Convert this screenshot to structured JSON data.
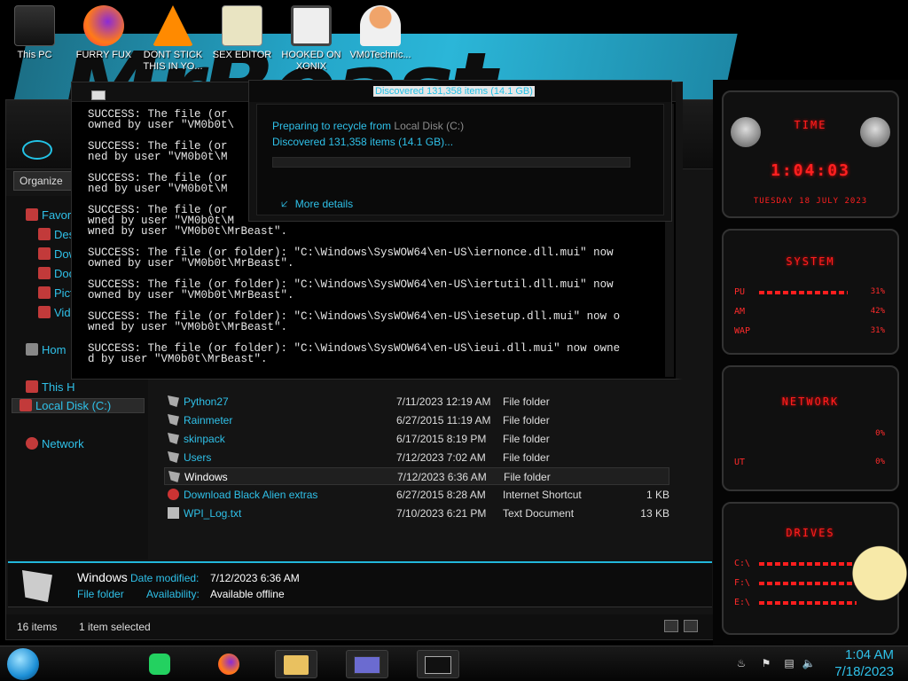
{
  "desktop": {
    "wallpaper_text": "MrBeast",
    "icons": [
      {
        "label": "This PC"
      },
      {
        "label": "FURRY FUX"
      },
      {
        "label": "DONT STICK THIS IN YO..."
      },
      {
        "label": "SEX EDITOR"
      },
      {
        "label": "HOOKED ON XONIX"
      },
      {
        "label": "VM0Technic..."
      }
    ]
  },
  "explorer": {
    "organize_label": "Organize",
    "nav": [
      {
        "label": "Favor"
      },
      {
        "label": "Des"
      },
      {
        "label": "Dow"
      },
      {
        "label": "Doc"
      },
      {
        "label": "Pict"
      },
      {
        "label": "Vide"
      },
      {
        "label": "Hom"
      },
      {
        "label": "This H"
      },
      {
        "label": "Local Disk (C:)"
      },
      {
        "label": "Network"
      }
    ],
    "files": [
      {
        "name": "Python27",
        "date": "7/11/2023 12:19 AM",
        "type": "File folder",
        "size": ""
      },
      {
        "name": "Rainmeter",
        "date": "6/27/2015 11:19 AM",
        "type": "File folder",
        "size": ""
      },
      {
        "name": "skinpack",
        "date": "6/17/2015 8:19 PM",
        "type": "File folder",
        "size": ""
      },
      {
        "name": "Users",
        "date": "7/12/2023 7:02 AM",
        "type": "File folder",
        "size": ""
      },
      {
        "name": "Windows",
        "date": "7/12/2023 6:36 AM",
        "type": "File folder",
        "size": ""
      },
      {
        "name": "Download Black Alien extras",
        "date": "6/27/2015 8:28 AM",
        "type": "Internet Shortcut",
        "size": "1 KB"
      },
      {
        "name": "WPI_Log.txt",
        "date": "7/10/2023 6:21 PM",
        "type": "Text Document",
        "size": "13 KB"
      }
    ],
    "details": {
      "name": "Windows",
      "type": "File folder",
      "modified_label": "Date modified:",
      "modified_value": "7/12/2023 6:36 AM",
      "availability_label": "Availability:",
      "availability_value": "Available offline"
    },
    "status": {
      "items": "16 items",
      "selected": "1 item selected"
    }
  },
  "cmd": {
    "lines": "SUCCESS: The file (or\nowned by user \"VM0b0t\\\n\nSUCCESS: The file (or\nned by user \"VM0b0t\\M\n\nSUCCESS: The file (or\nned by user \"VM0b0t\\M\n\nSUCCESS: The file (or\nwned by user \"VM0b0t\\M\nwned by user \"VM0b0t\\MrBeast\".\n\nSUCCESS: The file (or folder): \"C:\\Windows\\SysWOW64\\en-US\\iernonce.dll.mui\" now\nowned by user \"VM0b0t\\MrBeast\".\n\nSUCCESS: The file (or folder): \"C:\\Windows\\SysWOW64\\en-US\\iertutil.dll.mui\" now\nowned by user \"VM0b0t\\MrBeast\".\n\nSUCCESS: The file (or folder): \"C:\\Windows\\SysWOW64\\en-US\\iesetup.dll.mui\" now o\nwned by user \"VM0b0t\\MrBeast\".\n\nSUCCESS: The file (or folder): \"C:\\Windows\\SysWOW64\\en-US\\ieui.dll.mui\" now owne\nd by user \"VM0b0t\\MrBeast\"."
  },
  "progress": {
    "title": "Discovered 131,358 items (14.1 GB)",
    "line1_prefix": "Preparing to recycle from",
    "line1_source": "Local Disk (C:)",
    "line2": "Discovered 131,358 items (14.1 GB)...",
    "more_details": "More details",
    "progress_fraction": 0.0
  },
  "gadgets": {
    "time": {
      "title": "TIME",
      "clock": "1:04:03",
      "date": "TUESDAY 18 JULY 2023"
    },
    "system": {
      "title": "SYSTEM",
      "rows": [
        {
          "label": "PU",
          "value": "31%"
        },
        {
          "label": "AM",
          "value": "42%"
        },
        {
          "label": "WAP",
          "value": "31%"
        }
      ]
    },
    "network": {
      "title": "NETWORK",
      "rows": [
        {
          "label": "",
          "value": "0%"
        },
        {
          "label": "UT",
          "value": "0%"
        }
      ]
    },
    "drives": {
      "title": "DRIVES",
      "rows": [
        {
          "label": "C:\\"
        },
        {
          "label": "F:\\"
        },
        {
          "label": "E:\\"
        }
      ]
    }
  },
  "taskbar": {
    "time": "1:04 AM",
    "date": "7/18/2023",
    "apps": [
      "spotify-app",
      "firefox-app",
      "file-explorer-app",
      "control-panel-app",
      "cmd-app"
    ]
  },
  "colors": {
    "accent": "#2fc1e9",
    "gadget_red": "#ff1e1e",
    "background": "#000000"
  }
}
